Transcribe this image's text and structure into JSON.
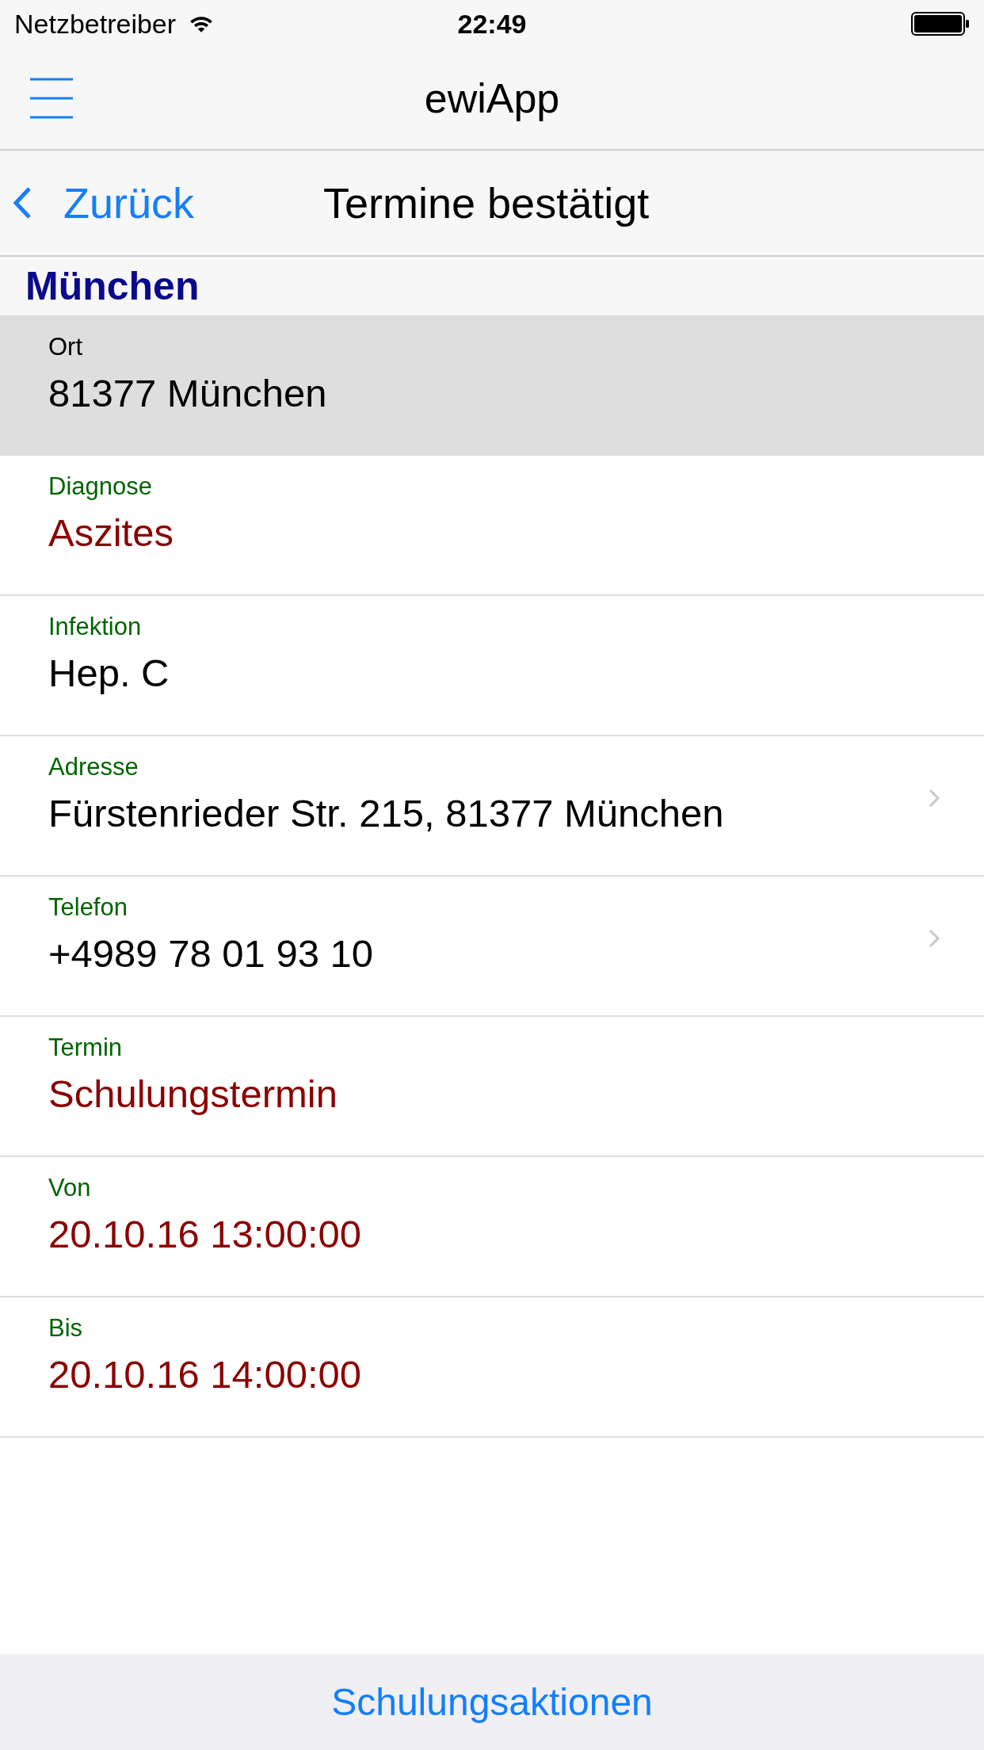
{
  "status_bar": {
    "carrier": "Netzbetreiber",
    "time": "22:49"
  },
  "app_bar": {
    "title": "ewiApp"
  },
  "nav_bar": {
    "back": "Zurück",
    "title": "Termine bestätigt"
  },
  "section": {
    "title": "München"
  },
  "rows": [
    {
      "label": "Ort",
      "value": "81377 München",
      "color": "#000000",
      "selected": true,
      "disclosure": false
    },
    {
      "label": "Diagnose",
      "value": "Aszites",
      "color": "#8b0000",
      "selected": false,
      "disclosure": false
    },
    {
      "label": "Infektion",
      "value": "Hep. C",
      "color": "#000000",
      "selected": false,
      "disclosure": false
    },
    {
      "label": "Adresse",
      "value": "Fürstenrieder Str. 215, 81377 München",
      "color": "#000000",
      "selected": false,
      "disclosure": true
    },
    {
      "label": "Telefon",
      "value": "+4989 78 01 93 10",
      "color": "#000000",
      "selected": false,
      "disclosure": true
    },
    {
      "label": "Termin",
      "value": "Schulungstermin",
      "color": "#8b0000",
      "selected": false,
      "disclosure": false
    },
    {
      "label": "Von",
      "value": "20.10.16 13:00:00",
      "color": "#8b0000",
      "selected": false,
      "disclosure": false
    },
    {
      "label": "Bis",
      "value": "20.10.16 14:00:00",
      "color": "#8b0000",
      "selected": false,
      "disclosure": false
    }
  ],
  "bottom_bar": {
    "button": "Schulungsaktionen"
  }
}
